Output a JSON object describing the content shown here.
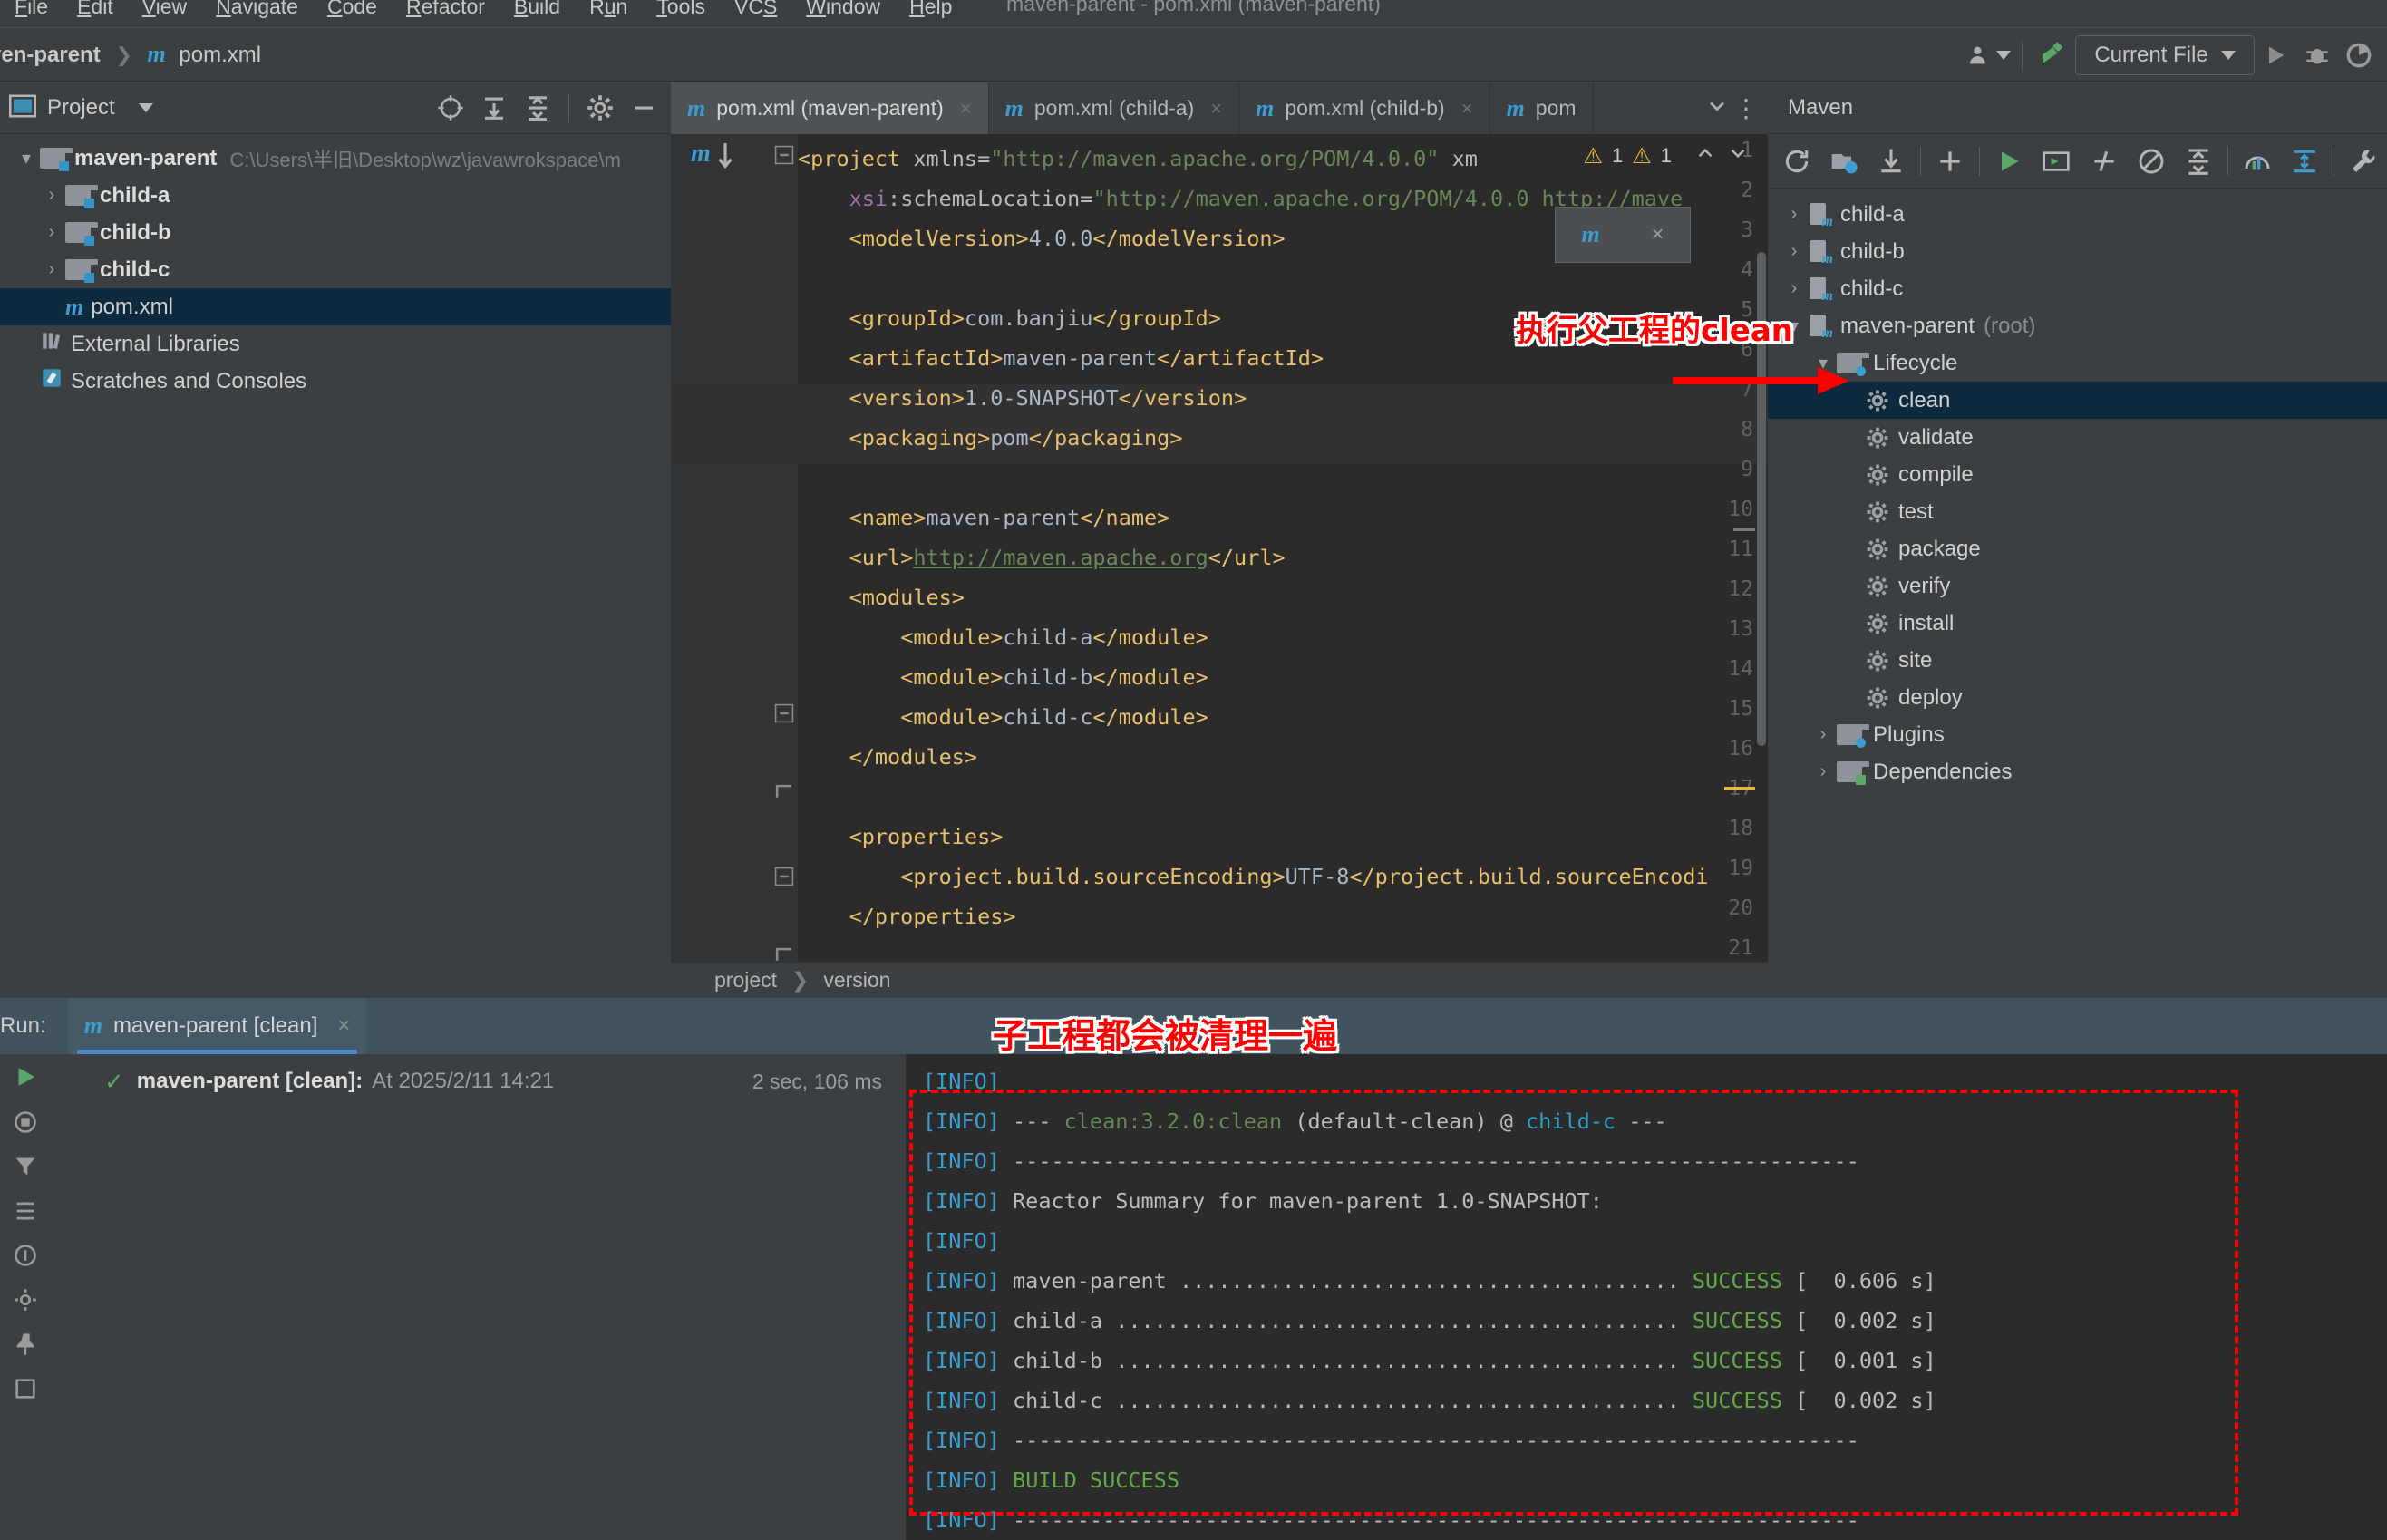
{
  "window": {
    "title": "maven-parent - pom.xml (maven-parent)"
  },
  "menubar": {
    "items": [
      "File",
      "Edit",
      "View",
      "Navigate",
      "Code",
      "Refactor",
      "Build",
      "Run",
      "Tools",
      "VCS",
      "Window",
      "Help"
    ]
  },
  "navbar": {
    "breadcrumb": [
      "ven-parent",
      "pom.xml"
    ],
    "run_config": "Current File",
    "icons": [
      "people-icon",
      "hammer-icon",
      "run-icon",
      "debug-icon",
      "coverage-icon"
    ]
  },
  "project_panel": {
    "title": "Project",
    "header_icons": [
      "locate-icon",
      "collapse-all-icon",
      "expand-all-icon",
      "gear-icon",
      "hide-icon"
    ],
    "tree": [
      {
        "label": "maven-parent",
        "path": "C:\\Users\\半旧\\Desktop\\wz\\javawrokspace\\m",
        "icon": "folder-module-icon",
        "arrow": "▾",
        "indent": 0,
        "bold": true,
        "selected": false
      },
      {
        "label": "child-a",
        "path": "",
        "icon": "folder-module-icon",
        "arrow": "›",
        "indent": 1,
        "bold": true,
        "selected": false
      },
      {
        "label": "child-b",
        "path": "",
        "icon": "folder-module-icon",
        "arrow": "›",
        "indent": 1,
        "bold": true,
        "selected": false
      },
      {
        "label": "child-c",
        "path": "",
        "icon": "folder-module-icon",
        "arrow": "›",
        "indent": 1,
        "bold": true,
        "selected": false
      },
      {
        "label": "pom.xml",
        "path": "",
        "icon": "maven-file-icon",
        "arrow": "",
        "indent": 1,
        "bold": false,
        "selected": true
      },
      {
        "label": "External Libraries",
        "path": "",
        "icon": "library-icon",
        "arrow": "",
        "indent": 0,
        "bold": false,
        "selected": false
      },
      {
        "label": "Scratches and Consoles",
        "path": "",
        "icon": "scratch-icon",
        "arrow": "",
        "indent": 0,
        "bold": false,
        "selected": false
      }
    ]
  },
  "editor": {
    "tabs": [
      {
        "label": "pom.xml (maven-parent)",
        "active": true
      },
      {
        "label": "pom.xml (child-a)",
        "active": false
      },
      {
        "label": "pom.xml (child-b)",
        "active": false
      },
      {
        "label": "pom",
        "active": false
      }
    ],
    "warnings": {
      "warn_count_1": "1",
      "warn_count_2": "1"
    },
    "popup": {
      "icon": "maven-reload-icon",
      "close": "×"
    },
    "bottom_breadcrumb": [
      "project",
      "version"
    ],
    "lines": [
      {
        "n": "1",
        "code": "<span class=\"tag\">&lt;project</span> <span class=\"attr\">xmlns=</span><span class=\"str\">\"http://maven.apache.org/POM/4.0.0\"</span> <span class=\"attr\">xm</span>"
      },
      {
        "n": "2",
        "code": "    <span class=\"ns\">xsi</span><span class=\"txt\">:</span><span class=\"attr\">schemaLocation=</span><span class=\"str\">\"http://maven.apache.org/POM/4.0.0 http://mave</span>"
      },
      {
        "n": "3",
        "code": "    <span class=\"tag\">&lt;modelVersion&gt;</span><span class=\"txt\">4.0.0</span><span class=\"tag\">&lt;/modelVersion&gt;</span>"
      },
      {
        "n": "4",
        "code": ""
      },
      {
        "n": "5",
        "code": "    <span class=\"tag\">&lt;groupId&gt;</span><span class=\"txt\">com.banjiu</span><span class=\"tag\">&lt;/groupId&gt;</span>"
      },
      {
        "n": "6",
        "code": "    <span class=\"tag\">&lt;artifactId&gt;</span><span class=\"txt\">maven-parent</span><span class=\"tag\">&lt;/artifactId&gt;</span>"
      },
      {
        "n": "7",
        "code": "    <span class=\"tag\">&lt;version&gt;</span><span class=\"txt\">1.0-SNAPSHOT</span><span class=\"tag\">&lt;/version&gt;</span>"
      },
      {
        "n": "8",
        "code": "    <span class=\"tag\">&lt;packaging&gt;</span><span class=\"txt\">pom</span><span class=\"tag\">&lt;/packaging&gt;</span>"
      },
      {
        "n": "9",
        "code": ""
      },
      {
        "n": "10",
        "code": "    <span class=\"tag\">&lt;name&gt;</span><span class=\"txt\">maven-parent</span><span class=\"tag\">&lt;/name&gt;</span>"
      },
      {
        "n": "11",
        "code": "    <span class=\"tag\">&lt;url&gt;</span><span class=\"lnk\">http://maven.apache.org</span><span class=\"tag\">&lt;/url&gt;</span>"
      },
      {
        "n": "12",
        "code": "    <span class=\"tag\">&lt;modules&gt;</span>"
      },
      {
        "n": "13",
        "code": "        <span class=\"tag\">&lt;module&gt;</span><span class=\"txt\">child-a</span><span class=\"tag\">&lt;/module&gt;</span>"
      },
      {
        "n": "14",
        "code": "        <span class=\"tag\">&lt;module&gt;</span><span class=\"txt\">child-b</span><span class=\"tag\">&lt;/module&gt;</span>"
      },
      {
        "n": "15",
        "code": "        <span class=\"tag\">&lt;module&gt;</span><span class=\"txt\">child-c</span><span class=\"tag\">&lt;/module&gt;</span>"
      },
      {
        "n": "16",
        "code": "    <span class=\"tag\">&lt;/modules&gt;</span>"
      },
      {
        "n": "17",
        "code": ""
      },
      {
        "n": "18",
        "code": "    <span class=\"tag\">&lt;properties&gt;</span>"
      },
      {
        "n": "19",
        "code": "        <span class=\"tag\">&lt;project.build.sourceEncoding&gt;</span><span class=\"txt\">UTF-8</span><span class=\"tag\">&lt;/project.build.sourceEncodi</span>"
      },
      {
        "n": "20",
        "code": "    <span class=\"tag\">&lt;/properties&gt;</span>"
      },
      {
        "n": "21",
        "code": ""
      }
    ]
  },
  "maven_panel": {
    "title": "Maven",
    "toolbar_icons": [
      "reload-all-icon",
      "add-module-icon",
      "download-sources-icon",
      "add-icon",
      "run-icon",
      "run-config-icon",
      "skip-tests-icon",
      "toggle-offline-icon",
      "collapse-all-icon",
      "show-diagram-icon",
      "expand-icon",
      "settings-icon"
    ],
    "tree": [
      {
        "label": "child-a",
        "arrow": "›",
        "indent": 0,
        "icon": "maven-module-icon",
        "selected": false,
        "dim": false
      },
      {
        "label": "child-b",
        "arrow": "›",
        "indent": 0,
        "icon": "maven-module-icon",
        "selected": false,
        "dim": false
      },
      {
        "label": "child-c",
        "arrow": "›",
        "indent": 0,
        "icon": "maven-module-icon",
        "selected": false,
        "dim": false
      },
      {
        "label": "maven-parent",
        "suffix": "(root)",
        "arrow": "▾",
        "indent": 0,
        "icon": "maven-module-icon",
        "selected": false,
        "dim": false
      },
      {
        "label": "Lifecycle",
        "arrow": "▾",
        "indent": 1,
        "icon": "lifecycle-folder-icon",
        "selected": false,
        "dim": false
      },
      {
        "label": "clean",
        "arrow": "",
        "indent": 2,
        "icon": "goal-gear-icon",
        "selected": true,
        "dim": false
      },
      {
        "label": "validate",
        "arrow": "",
        "indent": 2,
        "icon": "goal-gear-icon",
        "selected": false,
        "dim": false
      },
      {
        "label": "compile",
        "arrow": "",
        "indent": 2,
        "icon": "goal-gear-icon",
        "selected": false,
        "dim": false
      },
      {
        "label": "test",
        "arrow": "",
        "indent": 2,
        "icon": "goal-gear-icon",
        "selected": false,
        "dim": false
      },
      {
        "label": "package",
        "arrow": "",
        "indent": 2,
        "icon": "goal-gear-icon",
        "selected": false,
        "dim": false
      },
      {
        "label": "verify",
        "arrow": "",
        "indent": 2,
        "icon": "goal-gear-icon",
        "selected": false,
        "dim": false
      },
      {
        "label": "install",
        "arrow": "",
        "indent": 2,
        "icon": "goal-gear-icon",
        "selected": false,
        "dim": false
      },
      {
        "label": "site",
        "arrow": "",
        "indent": 2,
        "icon": "goal-gear-icon",
        "selected": false,
        "dim": false
      },
      {
        "label": "deploy",
        "arrow": "",
        "indent": 2,
        "icon": "goal-gear-icon",
        "selected": false,
        "dim": false
      },
      {
        "label": "Plugins",
        "arrow": "›",
        "indent": 1,
        "icon": "plugins-folder-icon",
        "selected": false,
        "dim": false
      },
      {
        "label": "Dependencies",
        "arrow": "›",
        "indent": 1,
        "icon": "dependencies-icon",
        "selected": false,
        "dim": false
      }
    ]
  },
  "run_panel": {
    "label": "Run:",
    "tab": "maven-parent [clean]",
    "tree_row": {
      "name": "maven-parent [clean]:",
      "at": "At 2025/2/11 14:21",
      "duration": "2 sec, 106 ms",
      "status_icon": "check-icon"
    },
    "console_lines": [
      {
        "prefix": "[INFO]",
        "rest": ""
      },
      {
        "prefix": "[INFO]",
        "rest": " --- <span class=\"plugin\">clean:3.2.0:clean</span> (default-clean) @ <span class=\"mod\">child-c</span> ---"
      },
      {
        "prefix": "[INFO]",
        "rest": " ------------------------------------------------------------------"
      },
      {
        "prefix": "[INFO]",
        "rest": " Reactor Summary for maven-parent 1.0-SNAPSHOT:"
      },
      {
        "prefix": "[INFO]",
        "rest": ""
      },
      {
        "prefix": "[INFO]",
        "rest": " maven-parent ....................................... <span class=\"ok\">SUCCESS</span> [  0.606 s]"
      },
      {
        "prefix": "[INFO]",
        "rest": " child-a ............................................ <span class=\"ok\">SUCCESS</span> [  0.002 s]"
      },
      {
        "prefix": "[INFO]",
        "rest": " child-b ............................................ <span class=\"ok\">SUCCESS</span> [  0.001 s]"
      },
      {
        "prefix": "[INFO]",
        "rest": " child-c ............................................ <span class=\"ok\">SUCCESS</span> [  0.002 s]"
      },
      {
        "prefix": "[INFO]",
        "rest": " ------------------------------------------------------------------"
      },
      {
        "prefix": "[INFO]",
        "rest": " <span class=\"ok\">BUILD SUCCESS</span>"
      },
      {
        "prefix": "[INFO]",
        "rest": " ------------------------------------------------------------------"
      }
    ]
  },
  "annotations": {
    "top": "执行父工程的clean",
    "bottom": "子工程都会被清理一遍",
    "color": "#ff0000"
  }
}
